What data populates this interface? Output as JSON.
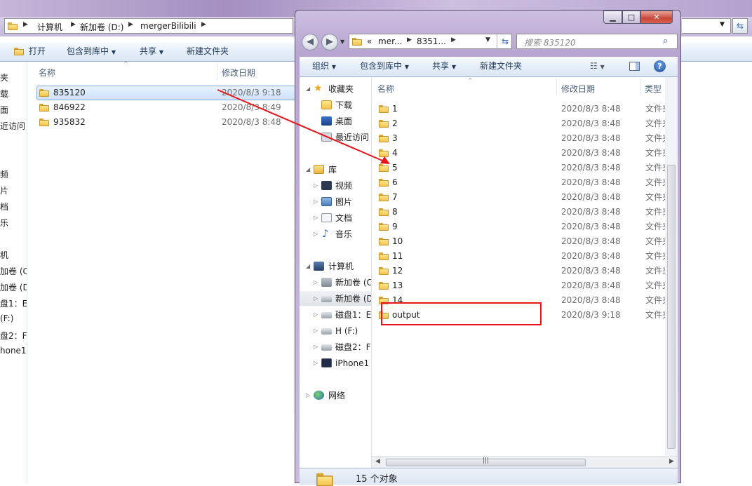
{
  "bg": {
    "breadcrumb": [
      "计算机",
      "新加卷 (D:)",
      "mergerBilibili"
    ],
    "toolbar": {
      "open": "打开",
      "include": "包含到库中",
      "share": "共享",
      "new_folder": "新建文件夹"
    },
    "nav_fragments": [
      "夹",
      "载",
      "面",
      "近访问",
      "频",
      "片",
      "档",
      "乐",
      "机",
      "加卷 (C",
      "加卷 (D",
      "盘1：E",
      "(F:)",
      "盘2：F",
      "hone1"
    ],
    "headers": {
      "name": "名称",
      "date": "修改日期"
    },
    "files": [
      {
        "name": "835120",
        "date": "2020/8/3 9:18"
      },
      {
        "name": "846922",
        "date": "2020/8/3 8:49"
      },
      {
        "name": "935832",
        "date": "2020/8/3 8:48"
      }
    ]
  },
  "fw": {
    "address": {
      "ellipsis": "«",
      "seg1": "mer...",
      "seg2": "8351..."
    },
    "search_placeholder": "搜索 835120",
    "toolbar": {
      "organize": "组织",
      "include": "包含到库中",
      "share": "共享",
      "new_folder": "新建文件夹"
    },
    "caption": {
      "min": "▁",
      "max": "□",
      "close": "✕"
    },
    "nav": {
      "favorites": "收藏夹",
      "downloads": "下载",
      "desktop": "桌面",
      "recent": "最近访问",
      "libraries": "库",
      "videos": "视频",
      "pictures": "图片",
      "documents": "文档",
      "music": "音乐",
      "computer": "计算机",
      "drive_c": "新加卷 (C",
      "drive_d": "新加卷 (D",
      "disk1": "磁盘1：E",
      "drive_h": "H (F:)",
      "disk2": "磁盘2：F",
      "iphone": "iPhone1",
      "network": "网络"
    },
    "headers": {
      "name": "名称",
      "date": "修改日期",
      "type": "类型"
    },
    "items": [
      {
        "name": "1",
        "date": "2020/8/3 8:48",
        "type": "文件夹"
      },
      {
        "name": "2",
        "date": "2020/8/3 8:48",
        "type": "文件夹"
      },
      {
        "name": "3",
        "date": "2020/8/3 8:48",
        "type": "文件夹"
      },
      {
        "name": "4",
        "date": "2020/8/3 8:48",
        "type": "文件夹"
      },
      {
        "name": "5",
        "date": "2020/8/3 8:48",
        "type": "文件夹"
      },
      {
        "name": "6",
        "date": "2020/8/3 8:48",
        "type": "文件夹"
      },
      {
        "name": "7",
        "date": "2020/8/3 8:48",
        "type": "文件夹"
      },
      {
        "name": "8",
        "date": "2020/8/3 8:48",
        "type": "文件夹"
      },
      {
        "name": "9",
        "date": "2020/8/3 8:48",
        "type": "文件夹"
      },
      {
        "name": "10",
        "date": "2020/8/3 8:48",
        "type": "文件夹"
      },
      {
        "name": "11",
        "date": "2020/8/3 8:48",
        "type": "文件夹"
      },
      {
        "name": "12",
        "date": "2020/8/3 8:48",
        "type": "文件夹"
      },
      {
        "name": "13",
        "date": "2020/8/3 8:48",
        "type": "文件夹"
      },
      {
        "name": "14",
        "date": "2020/8/3 8:48",
        "type": "文件夹"
      },
      {
        "name": "output",
        "date": "2020/8/3 9:18",
        "type": "文件夹"
      }
    ],
    "status": "15 个对象"
  },
  "annotation_color": "#e8141c"
}
